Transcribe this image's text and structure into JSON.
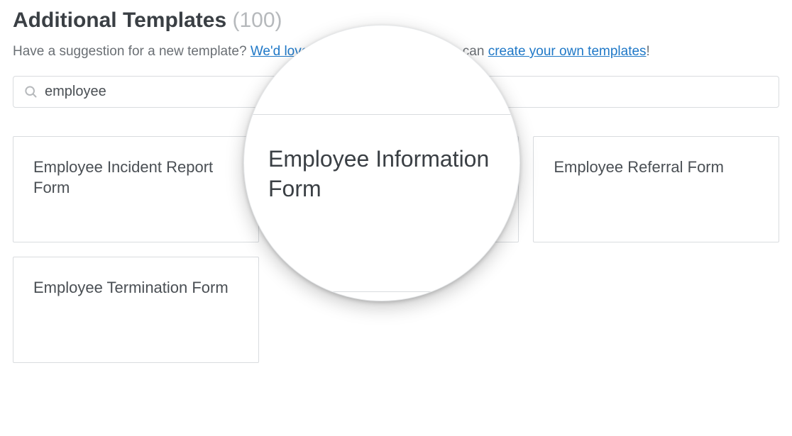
{
  "heading": {
    "title": "Additional Templates",
    "count": "(100)"
  },
  "subline": {
    "prefix": "Have a suggestion for a new template? ",
    "link1": "We'd love to hear from you",
    "mid": "! Or you can ",
    "link2": "create your own templates",
    "suffix": "!"
  },
  "search": {
    "value": "employee",
    "placeholder": ""
  },
  "cards": [
    {
      "title": "Employee Incident Report Form"
    },
    {
      "title": "Employee Information Form"
    },
    {
      "title": "Employee Referral Form"
    },
    {
      "title": "Employee Termination Form"
    }
  ],
  "lens": {
    "title": "Employee Information Form"
  }
}
